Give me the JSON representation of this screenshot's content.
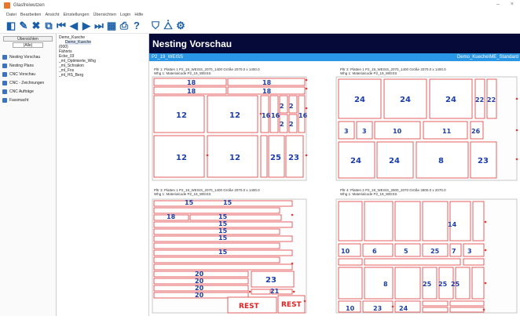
{
  "titlebar": {
    "title": "Glasfreiwutzen",
    "minimize": "–",
    "close": "×"
  },
  "menu": [
    "Datei",
    "Bearbeiten",
    "Ansicht",
    "Einstellungen",
    "Übersichten",
    "Login",
    "Hilfe"
  ],
  "toolbar": {
    "icons": [
      "layers-icon",
      "edit-icon",
      "delete-icon",
      "copy-icon",
      "first-icon",
      "prev-icon",
      "next-icon",
      "last-icon",
      "grid-icon",
      "print-icon",
      "help-icon",
      "flow-icon",
      "optimize-icon",
      "settings-icon"
    ],
    "glyphs": [
      "◧",
      "✎",
      "✖",
      "⧉",
      "⏮",
      "◀",
      "▶",
      "⏭",
      "▦",
      "⎙",
      "?",
      "⛉",
      "⧊",
      "⚙"
    ]
  },
  "leftnav": {
    "header": "Übersichten",
    "sub": "(Alle)",
    "items": [
      {
        "label": "Nesting Vorschau",
        "icon": "nesting-icon"
      },
      {
        "label": "Nesting Plans",
        "icon": "plan-icon"
      },
      {
        "label": "CNC Vorschau",
        "icon": "cnc-icon"
      },
      {
        "label": "CNC - Zeichnungen",
        "icon": "drawing-icon"
      },
      {
        "label": "CNC Aufträge",
        "icon": "order-icon"
      },
      {
        "label": "Fassmacht",
        "icon": "file-icon"
      }
    ]
  },
  "tree": [
    {
      "label": "Demo_Kueche",
      "level": 0
    },
    {
      "label": "Demo_Kueche",
      "level": 1,
      "selected": true
    },
    {
      "label": "(000)",
      "level": 0
    },
    {
      "label": "Fähnris",
      "level": 0
    },
    {
      "label": "Ecke_03",
      "level": 0
    },
    {
      "label": "_ml_Optimierte_Whg",
      "level": 0
    },
    {
      "label": "_ml_Schrakon",
      "level": 0
    },
    {
      "label": "_ml_Fns",
      "level": 0
    },
    {
      "label": "_ml_HS_Berg",
      "level": 0
    }
  ],
  "main": {
    "banner": "Nesting Vorschau",
    "subbar_left": "P2_19_WEISS",
    "subbar_right": "Demo_Kueche\\ME_Standard"
  },
  "plates": [
    {
      "line1": "Pltr 1: Platten 1 P2_19_WEISS_2070_1400  Größe 2070.0 x 1400.0",
      "line2": "Whg 1: Materialcode P2_19_WEISS"
    },
    {
      "line1": "Pltr 2: Platten 1 P2_19_WEISS_2070_1400  Größe 2070.0 x 1400.0",
      "line2": "Whg 1: Materialcode P2_19_WEISS"
    },
    {
      "line1": "Pltr 3: Platten 1 P2_19_WEISS_2070_1400  Größe 2070.0 x 1400.0",
      "line2": "Whg 1: Materialcode P2_19_WEISS"
    },
    {
      "line1": "Pltr 4: Platten 2 P2_19_WEISS_2800_2070  Größe 2800.0 x 2070.0",
      "line2": "Whg 1: Materialcode P2_19_WEISS"
    }
  ],
  "rest_label": "REST",
  "colors": {
    "banner": "#060a38",
    "subbar": "#2a96e6",
    "cut": "#e03a3a",
    "label": "#1c3ea8"
  }
}
